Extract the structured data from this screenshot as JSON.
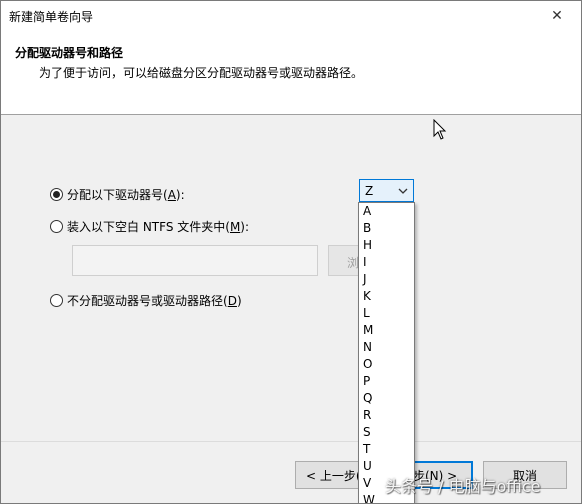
{
  "window": {
    "title": "新建简单卷向导",
    "close_glyph": "✕"
  },
  "header": {
    "title": "分配驱动器号和路径",
    "description": "为了便于访问，可以给磁盘分区分配驱动器号或驱动器路径。"
  },
  "options": {
    "assign_letter": {
      "prefix": "分配以下驱动器号(",
      "key": "A",
      "suffix": "):",
      "checked": true
    },
    "mount_folder": {
      "prefix": "装入以下空白 NTFS 文件夹中(",
      "key": "M",
      "suffix": "):",
      "checked": false
    },
    "no_assign": {
      "prefix": "不分配驱动器号或驱动器路径(",
      "key": "D",
      "suffix": ")",
      "checked": false
    }
  },
  "path_input": {
    "value": ""
  },
  "browse_button": {
    "label": "浏"
  },
  "drive_select": {
    "selected": "Z",
    "options": [
      "A",
      "B",
      "H",
      "I",
      "J",
      "K",
      "L",
      "M",
      "N",
      "O",
      "P",
      "Q",
      "R",
      "S",
      "T",
      "U",
      "V",
      "W"
    ]
  },
  "buttons": {
    "back": "< 上一步(",
    "next": "步(N) >",
    "cancel": "取消"
  },
  "watermark": "头条号 / 电脑与office"
}
